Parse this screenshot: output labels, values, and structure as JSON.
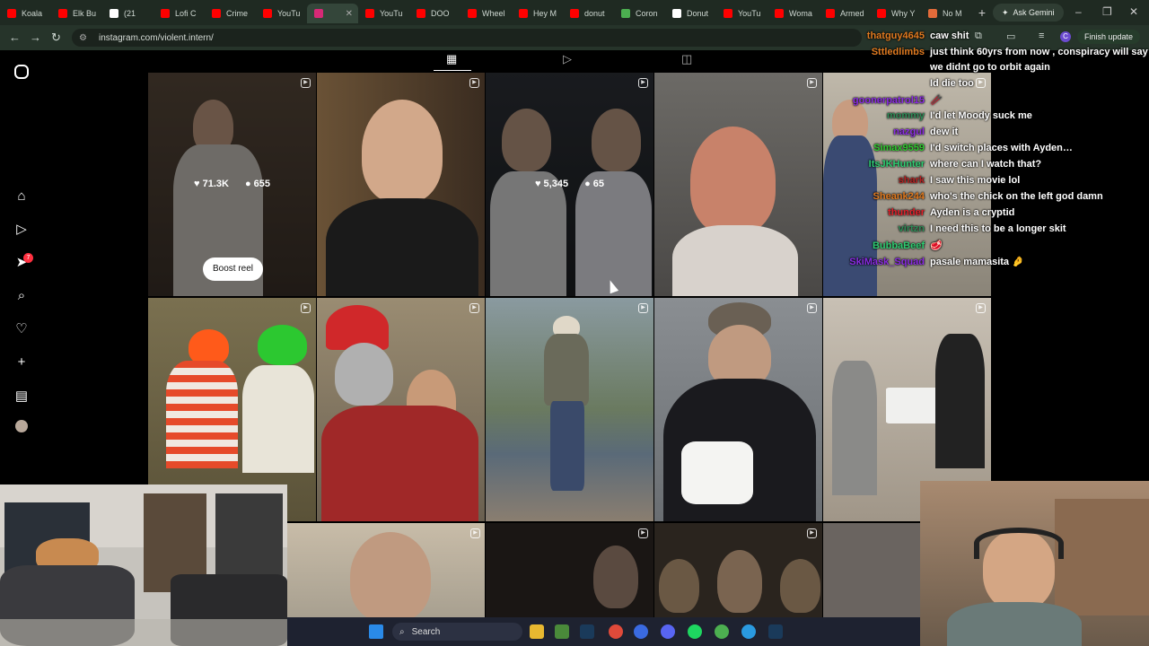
{
  "browser": {
    "tabs": [
      {
        "label": "Koala",
        "favicon_color": "#ff0000"
      },
      {
        "label": "Elk Bu",
        "favicon_color": "#ff0000"
      },
      {
        "label": "(21",
        "favicon_color": "#ffffff"
      },
      {
        "label": "Lofi C",
        "favicon_color": "#ff0000"
      },
      {
        "label": "Crime",
        "favicon_color": "#ff0000"
      },
      {
        "label": "YouTu",
        "favicon_color": "#ff0000"
      },
      {
        "label": "",
        "favicon_color": "#d62976"
      },
      {
        "label": "YouTu",
        "favicon_color": "#ff0000"
      },
      {
        "label": "DOO",
        "favicon_color": "#ff0000"
      },
      {
        "label": "Wheel",
        "favicon_color": "#ff0000"
      },
      {
        "label": "Hey M",
        "favicon_color": "#ff0000"
      },
      {
        "label": "donut",
        "favicon_color": "#ff0000"
      },
      {
        "label": "Coron",
        "favicon_color": "#4caf50"
      },
      {
        "label": "Donut",
        "favicon_color": "#ffffff"
      },
      {
        "label": "YouTu",
        "favicon_color": "#ff0000"
      },
      {
        "label": "Woma",
        "favicon_color": "#ff0000"
      },
      {
        "label": "Armed",
        "favicon_color": "#ff0000"
      },
      {
        "label": "Why Y",
        "favicon_color": "#ff0000"
      },
      {
        "label": "No M",
        "favicon_color": "#e36b3a"
      }
    ],
    "new_tab_label": "+",
    "ask_gemini": "Ask Gemini",
    "url": "instagram.com/violent.intern/",
    "finish_update": "Finish update",
    "profile_initial": "C"
  },
  "instagram": {
    "tiles_row1": [
      {
        "likes": "71.3K",
        "comments": "655",
        "boost": "Boost reel"
      },
      {},
      {
        "likes": "5,345",
        "comments": "65"
      },
      {},
      {}
    ],
    "notification_count": "7"
  },
  "chat": [
    {
      "user": "thatguy4645",
      "text": "caw shit",
      "color": "#e07a20"
    },
    {
      "user": "Sttledlimbs",
      "text": "just think 60yrs from now , conspiracy will say",
      "color": "#e07a20"
    },
    {
      "user": "",
      "text": "we didnt go to orbit again",
      "color": "#ffffff"
    },
    {
      "user": "",
      "text": "Id die too",
      "color": "#d0a030"
    },
    {
      "user": "goonerpatrol15",
      "text": "🥢",
      "color": "#8a2be2"
    },
    {
      "user": "mommy",
      "text": "I'd let Moody suck me",
      "color": "#2e8b57"
    },
    {
      "user": "nazgul",
      "text": "dew it",
      "color": "#8a2be2"
    },
    {
      "user": "Simax9559",
      "text": "I'd switch places with Ayden…",
      "color": "#2ec82e"
    },
    {
      "user": "ItsJKHunter",
      "text": "where can I watch that?",
      "color": "#2ecc71"
    },
    {
      "user": "shark",
      "text": "I saw this movie lol",
      "color": "#b22222"
    },
    {
      "user": "Sheank244",
      "text": "who's the chick on the left god damn",
      "color": "#e07a20"
    },
    {
      "user": "thunder",
      "text": "Ayden is a cryptid",
      "color": "#e0202a"
    },
    {
      "user": "virtzn",
      "text": "I need this to be a longer skit",
      "color": "#2e8b57"
    },
    {
      "user": "BubbaBeef",
      "text": "🥩",
      "color": "#2ecc71"
    },
    {
      "user": "SkiMask_Squad",
      "text": "pasale mamasita 🤌",
      "color": "#8a2be2"
    }
  ],
  "taskbar": {
    "search_label": "Search"
  }
}
